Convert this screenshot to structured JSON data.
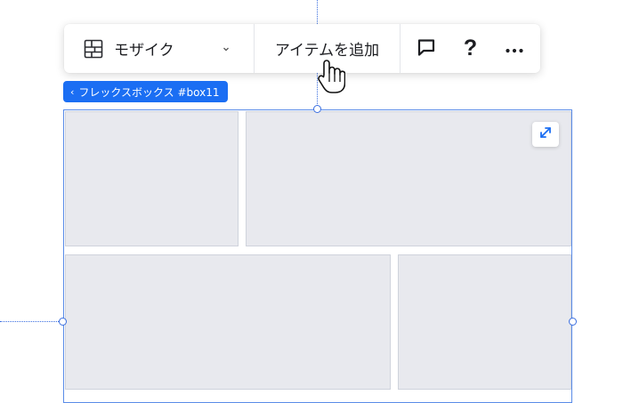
{
  "toolbar": {
    "layout_icon": "mosaic-grid-icon",
    "layout_label": "モザイク",
    "layout_chevron_icon": "chevron-down-icon",
    "add_item_label": "アイテムを追加",
    "comment_icon": "comment-icon",
    "help_label": "?",
    "more_icon": "more-horizontal-icon"
  },
  "breadcrumb": {
    "chevron_icon": "chevron-left-icon",
    "label": "フレックスボックス #box11"
  },
  "canvas": {
    "expand_icon": "expand-diagonal-icon",
    "guide_color": "#3b6fe0",
    "selection_color": "#5a8ce8",
    "accent_color": "#1b6ef3",
    "cell_color": "#e8e9ee"
  },
  "cursor": {
    "icon": "hand-pointer-cursor-icon"
  }
}
